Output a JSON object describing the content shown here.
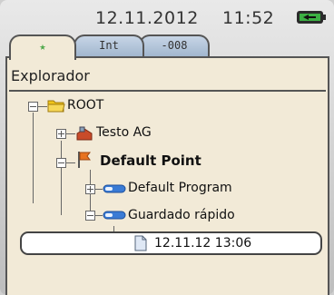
{
  "status": {
    "date": "12.11.2012",
    "time": "11:52"
  },
  "tabs": [
    {
      "label": "",
      "icon": "star-icon"
    },
    {
      "label": "Int"
    },
    {
      "label": "-008"
    }
  ],
  "explorer": {
    "title": "Explorador",
    "tree": [
      {
        "label": "ROOT",
        "icon": "folder-icon"
      },
      {
        "label": "Testo AG",
        "icon": "company-icon"
      },
      {
        "label": "Default Point",
        "icon": "flag-icon"
      },
      {
        "label": "Default Program",
        "icon": "program-icon"
      },
      {
        "label": "Guardado rápido",
        "icon": "program-icon"
      },
      {
        "label": "12.11.12 13:06",
        "icon": "document-icon",
        "selected": true
      }
    ]
  },
  "colors": {
    "panel": "#f2ead7",
    "tab_inactive": "#b3c6dc",
    "flag": "#e8731f",
    "folder": "#f0c419",
    "program": "#3a7bd5"
  }
}
